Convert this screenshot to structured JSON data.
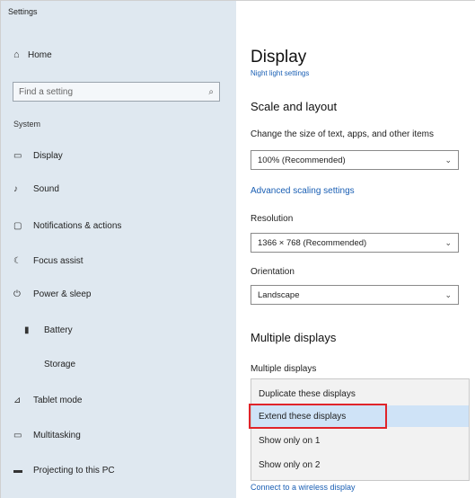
{
  "window": {
    "title": "Settings"
  },
  "sidebar": {
    "home_label": "Home",
    "search_placeholder": "Find a setting",
    "section_label": "System",
    "items": [
      {
        "icon": "display-icon",
        "label": "Display"
      },
      {
        "icon": "sound-icon",
        "label": "Sound"
      },
      {
        "icon": "notifications-icon",
        "label": "Notifications & actions"
      },
      {
        "icon": "focus-assist-icon",
        "label": "Focus assist"
      },
      {
        "icon": "power-icon",
        "label": "Power & sleep"
      },
      {
        "icon": "battery-icon",
        "label": "Battery"
      },
      {
        "icon": "storage-icon",
        "label": "Storage"
      },
      {
        "icon": "tablet-icon",
        "label": "Tablet mode"
      },
      {
        "icon": "multitasking-icon",
        "label": "Multitasking"
      },
      {
        "icon": "projecting-icon",
        "label": "Projecting to this PC"
      }
    ]
  },
  "main": {
    "title": "Display",
    "title_link": "Night light settings",
    "scale_section": "Scale and layout",
    "scale_label": "Change the size of text, apps, and other items",
    "scale_value": "100% (Recommended)",
    "advanced_link": "Advanced scaling settings",
    "resolution_label": "Resolution",
    "resolution_value": "1366 × 768 (Recommended)",
    "orientation_label": "Orientation",
    "orientation_value": "Landscape",
    "multi_section": "Multiple displays",
    "multi_label": "Multiple displays",
    "menu_options": [
      "Duplicate these displays",
      "Extend these displays",
      "Show only on 1",
      "Show only on 2"
    ],
    "below_link": "Connect to a wireless display"
  },
  "colors": {
    "sidebar_bg": "#dfe8f0",
    "accent_link": "#1a5fb4",
    "selection": "#cfe3f7",
    "highlight_outline": "#e0242a"
  }
}
